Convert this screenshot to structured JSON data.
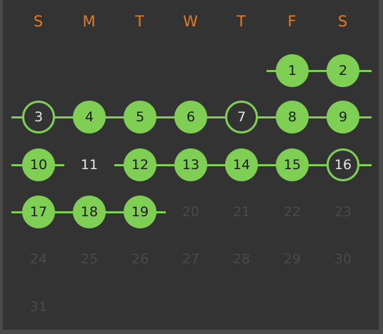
{
  "calendar": {
    "weekdays": [
      "S",
      "M",
      "T",
      "W",
      "T",
      "F",
      "S"
    ],
    "accent_color": "#e07b25",
    "completed_color": "#7ecf53",
    "weeks": [
      [
        null,
        null,
        null,
        null,
        null,
        {
          "day": "1",
          "status": "done"
        },
        {
          "day": "2",
          "status": "done"
        }
      ],
      [
        {
          "day": "3",
          "status": "missed"
        },
        {
          "day": "4",
          "status": "done"
        },
        {
          "day": "5",
          "status": "done"
        },
        {
          "day": "6",
          "status": "done"
        },
        {
          "day": "7",
          "status": "missed"
        },
        {
          "day": "8",
          "status": "done"
        },
        {
          "day": "9",
          "status": "done"
        }
      ],
      [
        {
          "day": "10",
          "status": "done"
        },
        {
          "day": "11",
          "status": "plain"
        },
        {
          "day": "12",
          "status": "done"
        },
        {
          "day": "13",
          "status": "done"
        },
        {
          "day": "14",
          "status": "done"
        },
        {
          "day": "15",
          "status": "done"
        },
        {
          "day": "16",
          "status": "missed"
        }
      ],
      [
        {
          "day": "17",
          "status": "done"
        },
        {
          "day": "18",
          "status": "done"
        },
        {
          "day": "19",
          "status": "done"
        },
        {
          "day": "20",
          "status": "future"
        },
        {
          "day": "21",
          "status": "future"
        },
        {
          "day": "22",
          "status": "future"
        },
        {
          "day": "23",
          "status": "future"
        }
      ],
      [
        {
          "day": "24",
          "status": "future"
        },
        {
          "day": "25",
          "status": "future"
        },
        {
          "day": "26",
          "status": "future"
        },
        {
          "day": "27",
          "status": "future"
        },
        {
          "day": "28",
          "status": "future"
        },
        {
          "day": "29",
          "status": "future"
        },
        {
          "day": "30",
          "status": "future"
        }
      ],
      [
        {
          "day": "31",
          "status": "future"
        },
        null,
        null,
        null,
        null,
        null,
        null
      ]
    ]
  }
}
